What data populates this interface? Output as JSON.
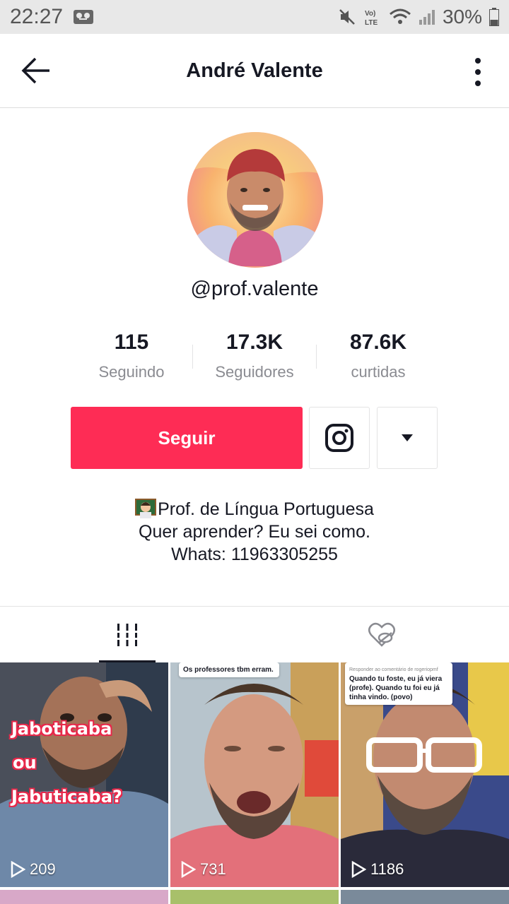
{
  "status_bar": {
    "time": "22:27",
    "battery": "30%",
    "network": "LTE"
  },
  "header": {
    "title": "André Valente"
  },
  "profile": {
    "username": "@prof.valente",
    "stats": [
      {
        "value": "115",
        "label": "Seguindo"
      },
      {
        "value": "17.3K",
        "label": "Seguidores"
      },
      {
        "value": "87.6K",
        "label": "curtidas"
      }
    ],
    "follow_label": "Seguir",
    "bio": [
      "Prof. de Língua Portuguesa",
      "Quer aprender? Eu sei como.",
      "Whats: 11963305255"
    ]
  },
  "videos": [
    {
      "views": "209",
      "overlay": [
        "Jaboticaba",
        "ou",
        "Jabuticaba?"
      ]
    },
    {
      "views": "731",
      "caption": "Os professores tbm erram."
    },
    {
      "views": "1186",
      "caption_small": "Responder ao comentário de rogeriopmf",
      "caption": "Quando tu foste, eu já viera (profe). Quando tu foi eu já tinha vindo. (povo)"
    }
  ],
  "colors": {
    "accent": "#fe2c55",
    "text": "#161823",
    "muted": "#8a8b91"
  },
  "icons": [
    "back-arrow-icon",
    "more-vertical-icon",
    "instagram-icon",
    "dropdown-caret-icon",
    "video-grid-icon",
    "liked-hidden-icon",
    "play-icon"
  ]
}
